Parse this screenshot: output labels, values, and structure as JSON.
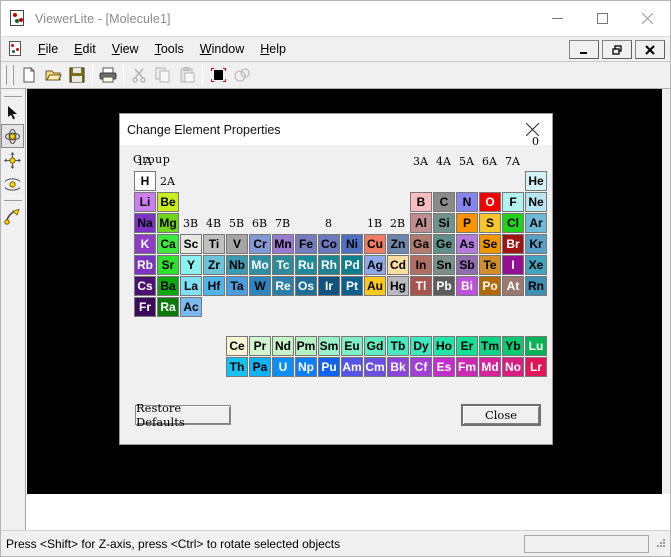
{
  "window": {
    "title": "ViewerLite - [Molecule1]",
    "icon": "molecule-icon",
    "controls": [
      {
        "name": "minimize",
        "glyph": "minimize-icon"
      },
      {
        "name": "maximize",
        "glyph": "maximize-icon"
      },
      {
        "name": "close",
        "glyph": "close-icon"
      }
    ]
  },
  "menubar": {
    "icon": "document-molecule-icon",
    "items": [
      {
        "label": "File",
        "mnemonic": "F"
      },
      {
        "label": "Edit",
        "mnemonic": "E"
      },
      {
        "label": "View",
        "mnemonic": "V"
      },
      {
        "label": "Tools",
        "mnemonic": "T"
      },
      {
        "label": "Window",
        "mnemonic": "W"
      },
      {
        "label": "Help",
        "mnemonic": "H"
      }
    ],
    "mdi_buttons": [
      {
        "name": "mdi-minimize",
        "label": "_"
      },
      {
        "name": "mdi-restore",
        "label": "❐"
      },
      {
        "name": "mdi-close",
        "label": "✕"
      }
    ]
  },
  "toolbar": {
    "buttons": [
      {
        "name": "new-file-icon",
        "enabled": true
      },
      {
        "name": "open-folder-icon",
        "enabled": true
      },
      {
        "name": "save-disk-icon",
        "enabled": true
      },
      {
        "name": "print-icon",
        "enabled": true
      },
      {
        "name": "cut-scissors-icon",
        "enabled": false
      },
      {
        "name": "copy-icon",
        "enabled": false
      },
      {
        "name": "paste-clipboard-icon",
        "enabled": false
      },
      {
        "name": "select-all-icon",
        "enabled": true
      },
      {
        "name": "display-style-icon",
        "enabled": false
      }
    ]
  },
  "lefttoolbar": {
    "buttons": [
      {
        "name": "select-arrow-tool",
        "selected": false
      },
      {
        "name": "rotate-tool",
        "selected": true
      },
      {
        "name": "translate-tool",
        "selected": false
      },
      {
        "name": "zoom-tool",
        "selected": false
      },
      {
        "name": "torsion-tool",
        "selected": false
      }
    ]
  },
  "statusbar": {
    "message": "Press <Shift> for Z-axis, press <Ctrl> to rotate selected objects"
  },
  "dialog": {
    "title": "Change Element Properties",
    "close_icon": "close-icon",
    "group_label": "Group",
    "restore_label": "Restore Defaults",
    "close_label": "Close",
    "column_labels": [
      {
        "text": "1A",
        "col": 0
      },
      {
        "text": "2A",
        "col": 1
      },
      {
        "text": "3B",
        "col": 2
      },
      {
        "text": "4B",
        "col": 3
      },
      {
        "text": "5B",
        "col": 4
      },
      {
        "text": "6B",
        "col": 5
      },
      {
        "text": "7B",
        "col": 6
      },
      {
        "text": "8",
        "col": 8
      },
      {
        "text": "1B",
        "col": 10
      },
      {
        "text": "2B",
        "col": 11
      },
      {
        "text": "3A",
        "col": 12
      },
      {
        "text": "4A",
        "col": 13
      },
      {
        "text": "5A",
        "col": 14
      },
      {
        "text": "6A",
        "col": 15
      },
      {
        "text": "7A",
        "col": 16
      },
      {
        "text": "0",
        "col": 17
      }
    ],
    "elements": [
      {
        "s": "H",
        "r": 0,
        "c": 0,
        "bg": "#ffffff",
        "fg": "#000000"
      },
      {
        "s": "He",
        "r": 0,
        "c": 17,
        "bg": "#d4f2f7",
        "fg": "#000000"
      },
      {
        "s": "Li",
        "r": 1,
        "c": 0,
        "bg": "#cc7ff0",
        "fg": "#000000"
      },
      {
        "s": "Be",
        "r": 1,
        "c": 1,
        "bg": "#c8ec1e",
        "fg": "#000000"
      },
      {
        "s": "B",
        "r": 1,
        "c": 12,
        "bg": "#f6bcc0",
        "fg": "#000000"
      },
      {
        "s": "C",
        "r": 1,
        "c": 13,
        "bg": "#8a8a8a",
        "fg": "#000000"
      },
      {
        "s": "N",
        "r": 1,
        "c": 14,
        "bg": "#8585f0",
        "fg": "#000000"
      },
      {
        "s": "O",
        "r": 1,
        "c": 15,
        "bg": "#f00000",
        "fg": "#ffffff"
      },
      {
        "s": "F",
        "r": 1,
        "c": 16,
        "bg": "#b3f0f0",
        "fg": "#000000"
      },
      {
        "s": "Ne",
        "r": 1,
        "c": 17,
        "bg": "#b9e6f2",
        "fg": "#000000"
      },
      {
        "s": "Na",
        "r": 2,
        "c": 0,
        "bg": "#7b34c1",
        "fg": "#000000"
      },
      {
        "s": "Mg",
        "r": 2,
        "c": 1,
        "bg": "#6fd61c",
        "fg": "#000000"
      },
      {
        "s": "Al",
        "r": 2,
        "c": 12,
        "bg": "#bf8f8f",
        "fg": "#000000"
      },
      {
        "s": "Si",
        "r": 2,
        "c": 13,
        "bg": "#71918f",
        "fg": "#000000"
      },
      {
        "s": "P",
        "r": 2,
        "c": 14,
        "bg": "#f99300",
        "fg": "#000000"
      },
      {
        "s": "S",
        "r": 2,
        "c": 15,
        "bg": "#f5c72c",
        "fg": "#000000"
      },
      {
        "s": "Cl",
        "r": 2,
        "c": 16,
        "bg": "#1ed21e",
        "fg": "#000000"
      },
      {
        "s": "Ar",
        "r": 2,
        "c": 17,
        "bg": "#6eb9d6",
        "fg": "#000000"
      },
      {
        "s": "K",
        "r": 3,
        "c": 0,
        "bg": "#8e3cc4",
        "fg": "#ffffff"
      },
      {
        "s": "Ca",
        "r": 3,
        "c": 1,
        "bg": "#3ce83c",
        "fg": "#000000"
      },
      {
        "s": "Sc",
        "r": 3,
        "c": 2,
        "bg": "#e8e8e0",
        "fg": "#000000"
      },
      {
        "s": "Ti",
        "r": 3,
        "c": 3,
        "bg": "#c0c0c0",
        "fg": "#000000"
      },
      {
        "s": "V",
        "r": 3,
        "c": 4,
        "bg": "#a5a5a5",
        "fg": "#000000"
      },
      {
        "s": "Cr",
        "r": 3,
        "c": 5,
        "bg": "#8399d6",
        "fg": "#000000"
      },
      {
        "s": "Mn",
        "r": 3,
        "c": 6,
        "bg": "#9c79d1",
        "fg": "#000000"
      },
      {
        "s": "Fe",
        "r": 3,
        "c": 7,
        "bg": "#737dbc",
        "fg": "#000000"
      },
      {
        "s": "Co",
        "r": 3,
        "c": 8,
        "bg": "#6c78bb",
        "fg": "#000000"
      },
      {
        "s": "Ni",
        "r": 3,
        "c": 9,
        "bg": "#4f6fbf",
        "fg": "#000000"
      },
      {
        "s": "Cu",
        "r": 3,
        "c": 10,
        "bg": "#f07c63",
        "fg": "#000000"
      },
      {
        "s": "Zn",
        "r": 3,
        "c": 11,
        "bg": "#6d87ab",
        "fg": "#000000"
      },
      {
        "s": "Ga",
        "r": 3,
        "c": 12,
        "bg": "#b27c70",
        "fg": "#000000"
      },
      {
        "s": "Ge",
        "r": 3,
        "c": 13,
        "bg": "#5f8f8b",
        "fg": "#000000"
      },
      {
        "s": "As",
        "r": 3,
        "c": 14,
        "bg": "#b57ae0",
        "fg": "#000000"
      },
      {
        "s": "Se",
        "r": 3,
        "c": 15,
        "bg": "#f09600",
        "fg": "#000000"
      },
      {
        "s": "Br",
        "r": 3,
        "c": 16,
        "bg": "#a01414",
        "fg": "#ffffff"
      },
      {
        "s": "Kr",
        "r": 3,
        "c": 17,
        "bg": "#5ba0c4",
        "fg": "#000000"
      },
      {
        "s": "Rb",
        "r": 4,
        "c": 0,
        "bg": "#7b34c1",
        "fg": "#ffffff"
      },
      {
        "s": "Sr",
        "r": 4,
        "c": 1,
        "bg": "#2fe02f",
        "fg": "#000000"
      },
      {
        "s": "Y",
        "r": 4,
        "c": 2,
        "bg": "#8cf2ef",
        "fg": "#000000"
      },
      {
        "s": "Zr",
        "r": 4,
        "c": 3,
        "bg": "#6cc4d6",
        "fg": "#000000"
      },
      {
        "s": "Nb",
        "r": 4,
        "c": 4,
        "bg": "#3a9ab0",
        "fg": "#000000"
      },
      {
        "s": "Mo",
        "r": 4,
        "c": 5,
        "bg": "#2e8fa0",
        "fg": "#ffffff"
      },
      {
        "s": "Tc",
        "r": 4,
        "c": 6,
        "bg": "#2f8b97",
        "fg": "#ffffff"
      },
      {
        "s": "Ru",
        "r": 4,
        "c": 7,
        "bg": "#1f8a98",
        "fg": "#ffffff"
      },
      {
        "s": "Rh",
        "r": 4,
        "c": 8,
        "bg": "#1d8391",
        "fg": "#ffffff"
      },
      {
        "s": "Pd",
        "r": 4,
        "c": 9,
        "bg": "#0f7d8c",
        "fg": "#ffffff"
      },
      {
        "s": "Ag",
        "r": 4,
        "c": 10,
        "bg": "#8fa8e8",
        "fg": "#000000"
      },
      {
        "s": "Cd",
        "r": 4,
        "c": 11,
        "bg": "#fbdda0",
        "fg": "#000000"
      },
      {
        "s": "In",
        "r": 4,
        "c": 12,
        "bg": "#b06f62",
        "fg": "#000000"
      },
      {
        "s": "Sn",
        "r": 4,
        "c": 13,
        "bg": "#7a8f8c",
        "fg": "#000000"
      },
      {
        "s": "Sb",
        "r": 4,
        "c": 14,
        "bg": "#8f6bb0",
        "fg": "#000000"
      },
      {
        "s": "Te",
        "r": 4,
        "c": 15,
        "bg": "#d18e2a",
        "fg": "#000000"
      },
      {
        "s": "I",
        "r": 4,
        "c": 16,
        "bg": "#930e93",
        "fg": "#ffffff"
      },
      {
        "s": "Xe",
        "r": 4,
        "c": 17,
        "bg": "#44a3bd",
        "fg": "#000000"
      },
      {
        "s": "Cs",
        "r": 5,
        "c": 0,
        "bg": "#4b1270",
        "fg": "#ffffff"
      },
      {
        "s": "Ba",
        "r": 5,
        "c": 1,
        "bg": "#10a810",
        "fg": "#000000"
      },
      {
        "s": "La",
        "r": 5,
        "c": 2,
        "bg": "#7fe0f5",
        "fg": "#000000"
      },
      {
        "s": "Hf",
        "r": 5,
        "c": 3,
        "bg": "#4cb6e8",
        "fg": "#000000"
      },
      {
        "s": "Ta",
        "r": 5,
        "c": 4,
        "bg": "#4a9ede",
        "fg": "#000000"
      },
      {
        "s": "W",
        "r": 5,
        "c": 5,
        "bg": "#2f85bf",
        "fg": "#000000"
      },
      {
        "s": "Re",
        "r": 5,
        "c": 6,
        "bg": "#2b7fa8",
        "fg": "#ffffff"
      },
      {
        "s": "Os",
        "r": 5,
        "c": 7,
        "bg": "#1f6d97",
        "fg": "#ffffff"
      },
      {
        "s": "Ir",
        "r": 5,
        "c": 8,
        "bg": "#11527e",
        "fg": "#ffffff"
      },
      {
        "s": "Pt",
        "r": 5,
        "c": 9,
        "bg": "#0f5f8f",
        "fg": "#ffffff"
      },
      {
        "s": "Au",
        "r": 5,
        "c": 10,
        "bg": "#fbc81e",
        "fg": "#000000"
      },
      {
        "s": "Hg",
        "r": 5,
        "c": 11,
        "bg": "#b9b9c0",
        "fg": "#000000"
      },
      {
        "s": "Tl",
        "r": 5,
        "c": 12,
        "bg": "#a85550",
        "fg": "#ffffff"
      },
      {
        "s": "Pb",
        "r": 5,
        "c": 13,
        "bg": "#5c5c5c",
        "fg": "#ffffff"
      },
      {
        "s": "Bi",
        "r": 5,
        "c": 14,
        "bg": "#bb52d9",
        "fg": "#ffffff"
      },
      {
        "s": "Po",
        "r": 5,
        "c": 15,
        "bg": "#b06a0a",
        "fg": "#ffffff"
      },
      {
        "s": "At",
        "r": 5,
        "c": 16,
        "bg": "#9a7a70",
        "fg": "#ffffff"
      },
      {
        "s": "Rn",
        "r": 5,
        "c": 17,
        "bg": "#3f90b5",
        "fg": "#000000"
      },
      {
        "s": "Fr",
        "r": 6,
        "c": 0,
        "bg": "#3c0a5c",
        "fg": "#ffffff"
      },
      {
        "s": "Ra",
        "r": 6,
        "c": 1,
        "bg": "#0b7a0b",
        "fg": "#ffffff"
      },
      {
        "s": "Ac",
        "r": 6,
        "c": 2,
        "bg": "#7ab8f0",
        "fg": "#000000"
      }
    ],
    "lanthanides": [
      {
        "s": "Ce",
        "bg": "#fbf4d2",
        "fg": "#000000"
      },
      {
        "s": "Pr",
        "bg": "#d2f5cf",
        "fg": "#000000"
      },
      {
        "s": "Nd",
        "bg": "#c6f2c6",
        "fg": "#000000"
      },
      {
        "s": "Pm",
        "bg": "#b4f2c6",
        "fg": "#000000"
      },
      {
        "s": "Sm",
        "bg": "#9af0c8",
        "fg": "#000000"
      },
      {
        "s": "Eu",
        "bg": "#7eeec6",
        "fg": "#000000"
      },
      {
        "s": "Gd",
        "bg": "#62ecc4",
        "fg": "#000000"
      },
      {
        "s": "Tb",
        "bg": "#4ae8c0",
        "fg": "#000000"
      },
      {
        "s": "Dy",
        "bg": "#3ce8bd",
        "fg": "#000000"
      },
      {
        "s": "Ho",
        "bg": "#22e5a8",
        "fg": "#000000"
      },
      {
        "s": "Er",
        "bg": "#14e096",
        "fg": "#000000"
      },
      {
        "s": "Tm",
        "bg": "#0ed486",
        "fg": "#000000"
      },
      {
        "s": "Yb",
        "bg": "#0ac96e",
        "fg": "#000000"
      },
      {
        "s": "Lu",
        "bg": "#06b455",
        "fg": "#ffffff"
      }
    ],
    "actinides": [
      {
        "s": "Th",
        "bg": "#12c2f0",
        "fg": "#000000"
      },
      {
        "s": "Pa",
        "bg": "#0eb2f5",
        "fg": "#000000"
      },
      {
        "s": "U",
        "bg": "#0c8ef7",
        "fg": "#ffffff"
      },
      {
        "s": "Np",
        "bg": "#0d7ef7",
        "fg": "#ffffff"
      },
      {
        "s": "Pu",
        "bg": "#1161f2",
        "fg": "#ffffff"
      },
      {
        "s": "Am",
        "bg": "#5454e8",
        "fg": "#ffffff"
      },
      {
        "s": "Cm",
        "bg": "#6a4fe0",
        "fg": "#ffffff"
      },
      {
        "s": "Bk",
        "bg": "#8a46dc",
        "fg": "#ffffff"
      },
      {
        "s": "Cf",
        "bg": "#a13fd6",
        "fg": "#ffffff"
      },
      {
        "s": "Es",
        "bg": "#c42ec8",
        "fg": "#ffffff"
      },
      {
        "s": "Fm",
        "bg": "#cf29b4",
        "fg": "#ffffff"
      },
      {
        "s": "Md",
        "bg": "#d8229a",
        "fg": "#ffffff"
      },
      {
        "s": "No",
        "bg": "#dc1d80",
        "fg": "#ffffff"
      },
      {
        "s": "Lr",
        "bg": "#e01656",
        "fg": "#ffffff"
      }
    ]
  }
}
